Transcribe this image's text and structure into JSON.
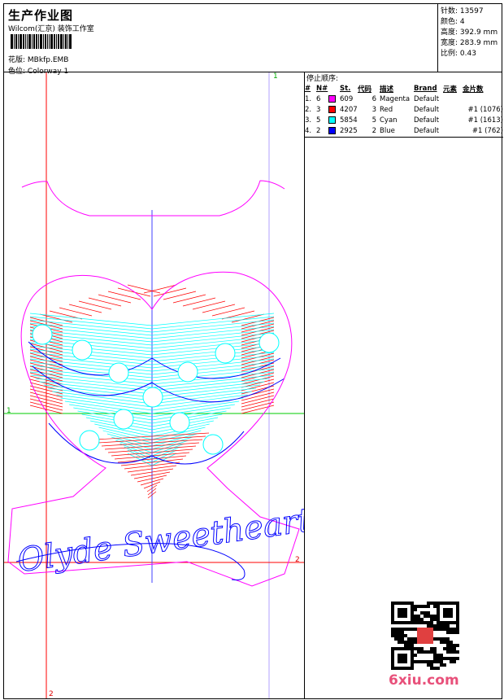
{
  "header": {
    "title": "生产作业图",
    "company": "Wilcom(汇京) 装饰工作室",
    "design_label": "花版:",
    "design_value": "MBkfp.EMB",
    "colorway_label": "色位:",
    "colorway_value": "Colorway 1"
  },
  "info": [
    {
      "label": "针数:",
      "value": "13597"
    },
    {
      "label": "颜色:",
      "value": "4"
    },
    {
      "label": "高度:",
      "value": "392.9 mm"
    },
    {
      "label": "宽度:",
      "value": "283.9 mm"
    },
    {
      "label": "比例:",
      "value": "0.43"
    }
  ],
  "stop_sequence": {
    "title": "停止顺序:",
    "columns": [
      "#",
      "N#",
      "",
      "St.",
      "代码",
      "描述",
      "Brand",
      "元素",
      "金片数"
    ],
    "rows": [
      {
        "idx": "1.",
        "n": "6",
        "color": "#ff00ff",
        "st": "609",
        "code": "6",
        "desc": "Magenta",
        "brand": "Default",
        "elem": "",
        "seq": ""
      },
      {
        "idx": "2.",
        "n": "3",
        "color": "#ff0000",
        "st": "4207",
        "code": "3",
        "desc": "Red",
        "brand": "Default",
        "elem": "",
        "seq": "#1 (1076)"
      },
      {
        "idx": "3.",
        "n": "5",
        "color": "#00ffff",
        "st": "5854",
        "code": "5",
        "desc": "Cyan",
        "brand": "Default",
        "elem": "",
        "seq": "#1 (1613)"
      },
      {
        "idx": "4.",
        "n": "2",
        "color": "#0000ff",
        "st": "2925",
        "code": "2",
        "desc": "Blue",
        "brand": "Default",
        "elem": "",
        "seq": "#1 (762)"
      }
    ]
  },
  "guides": {
    "top": "1",
    "left": "1",
    "right": "2",
    "bottom": "2"
  },
  "watermark": "6xiu.com",
  "colors": {
    "magenta": "#ff00ff",
    "red": "#ff0000",
    "cyan": "#00ffff",
    "blue": "#0000ff",
    "green": "#00cc00"
  }
}
